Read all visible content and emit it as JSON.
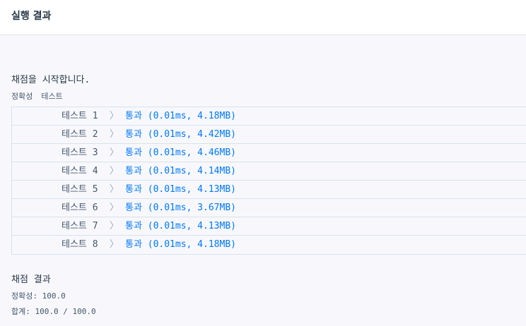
{
  "header": {
    "title": "실행 결과"
  },
  "output": {
    "start_message": "채점을 시작합니다.",
    "section_accuracy": "정확성",
    "section_test": "테스트",
    "chevron": "〉",
    "tests": [
      {
        "name": "테스트 1",
        "result": "통과 (0.01ms, 4.18MB)"
      },
      {
        "name": "테스트 2",
        "result": "통과 (0.01ms, 4.42MB)"
      },
      {
        "name": "테스트 3",
        "result": "통과 (0.01ms, 4.46MB)"
      },
      {
        "name": "테스트 4",
        "result": "통과 (0.01ms, 4.14MB)"
      },
      {
        "name": "테스트 5",
        "result": "통과 (0.01ms, 4.13MB)"
      },
      {
        "name": "테스트 6",
        "result": "통과 (0.01ms, 3.67MB)"
      },
      {
        "name": "테스트 7",
        "result": "통과 (0.01ms, 4.13MB)"
      },
      {
        "name": "테스트 8",
        "result": "통과 (0.01ms, 4.18MB)"
      }
    ],
    "grading_title": "채점 결과",
    "accuracy_line": "정확성: 100.0",
    "total_line": "합계: 100.0 / 100.0"
  },
  "colors": {
    "pass": "#0078ff",
    "text": "#263747",
    "muted": "#44576c",
    "border": "#d7e2eb",
    "background": "#f8f8fc"
  }
}
